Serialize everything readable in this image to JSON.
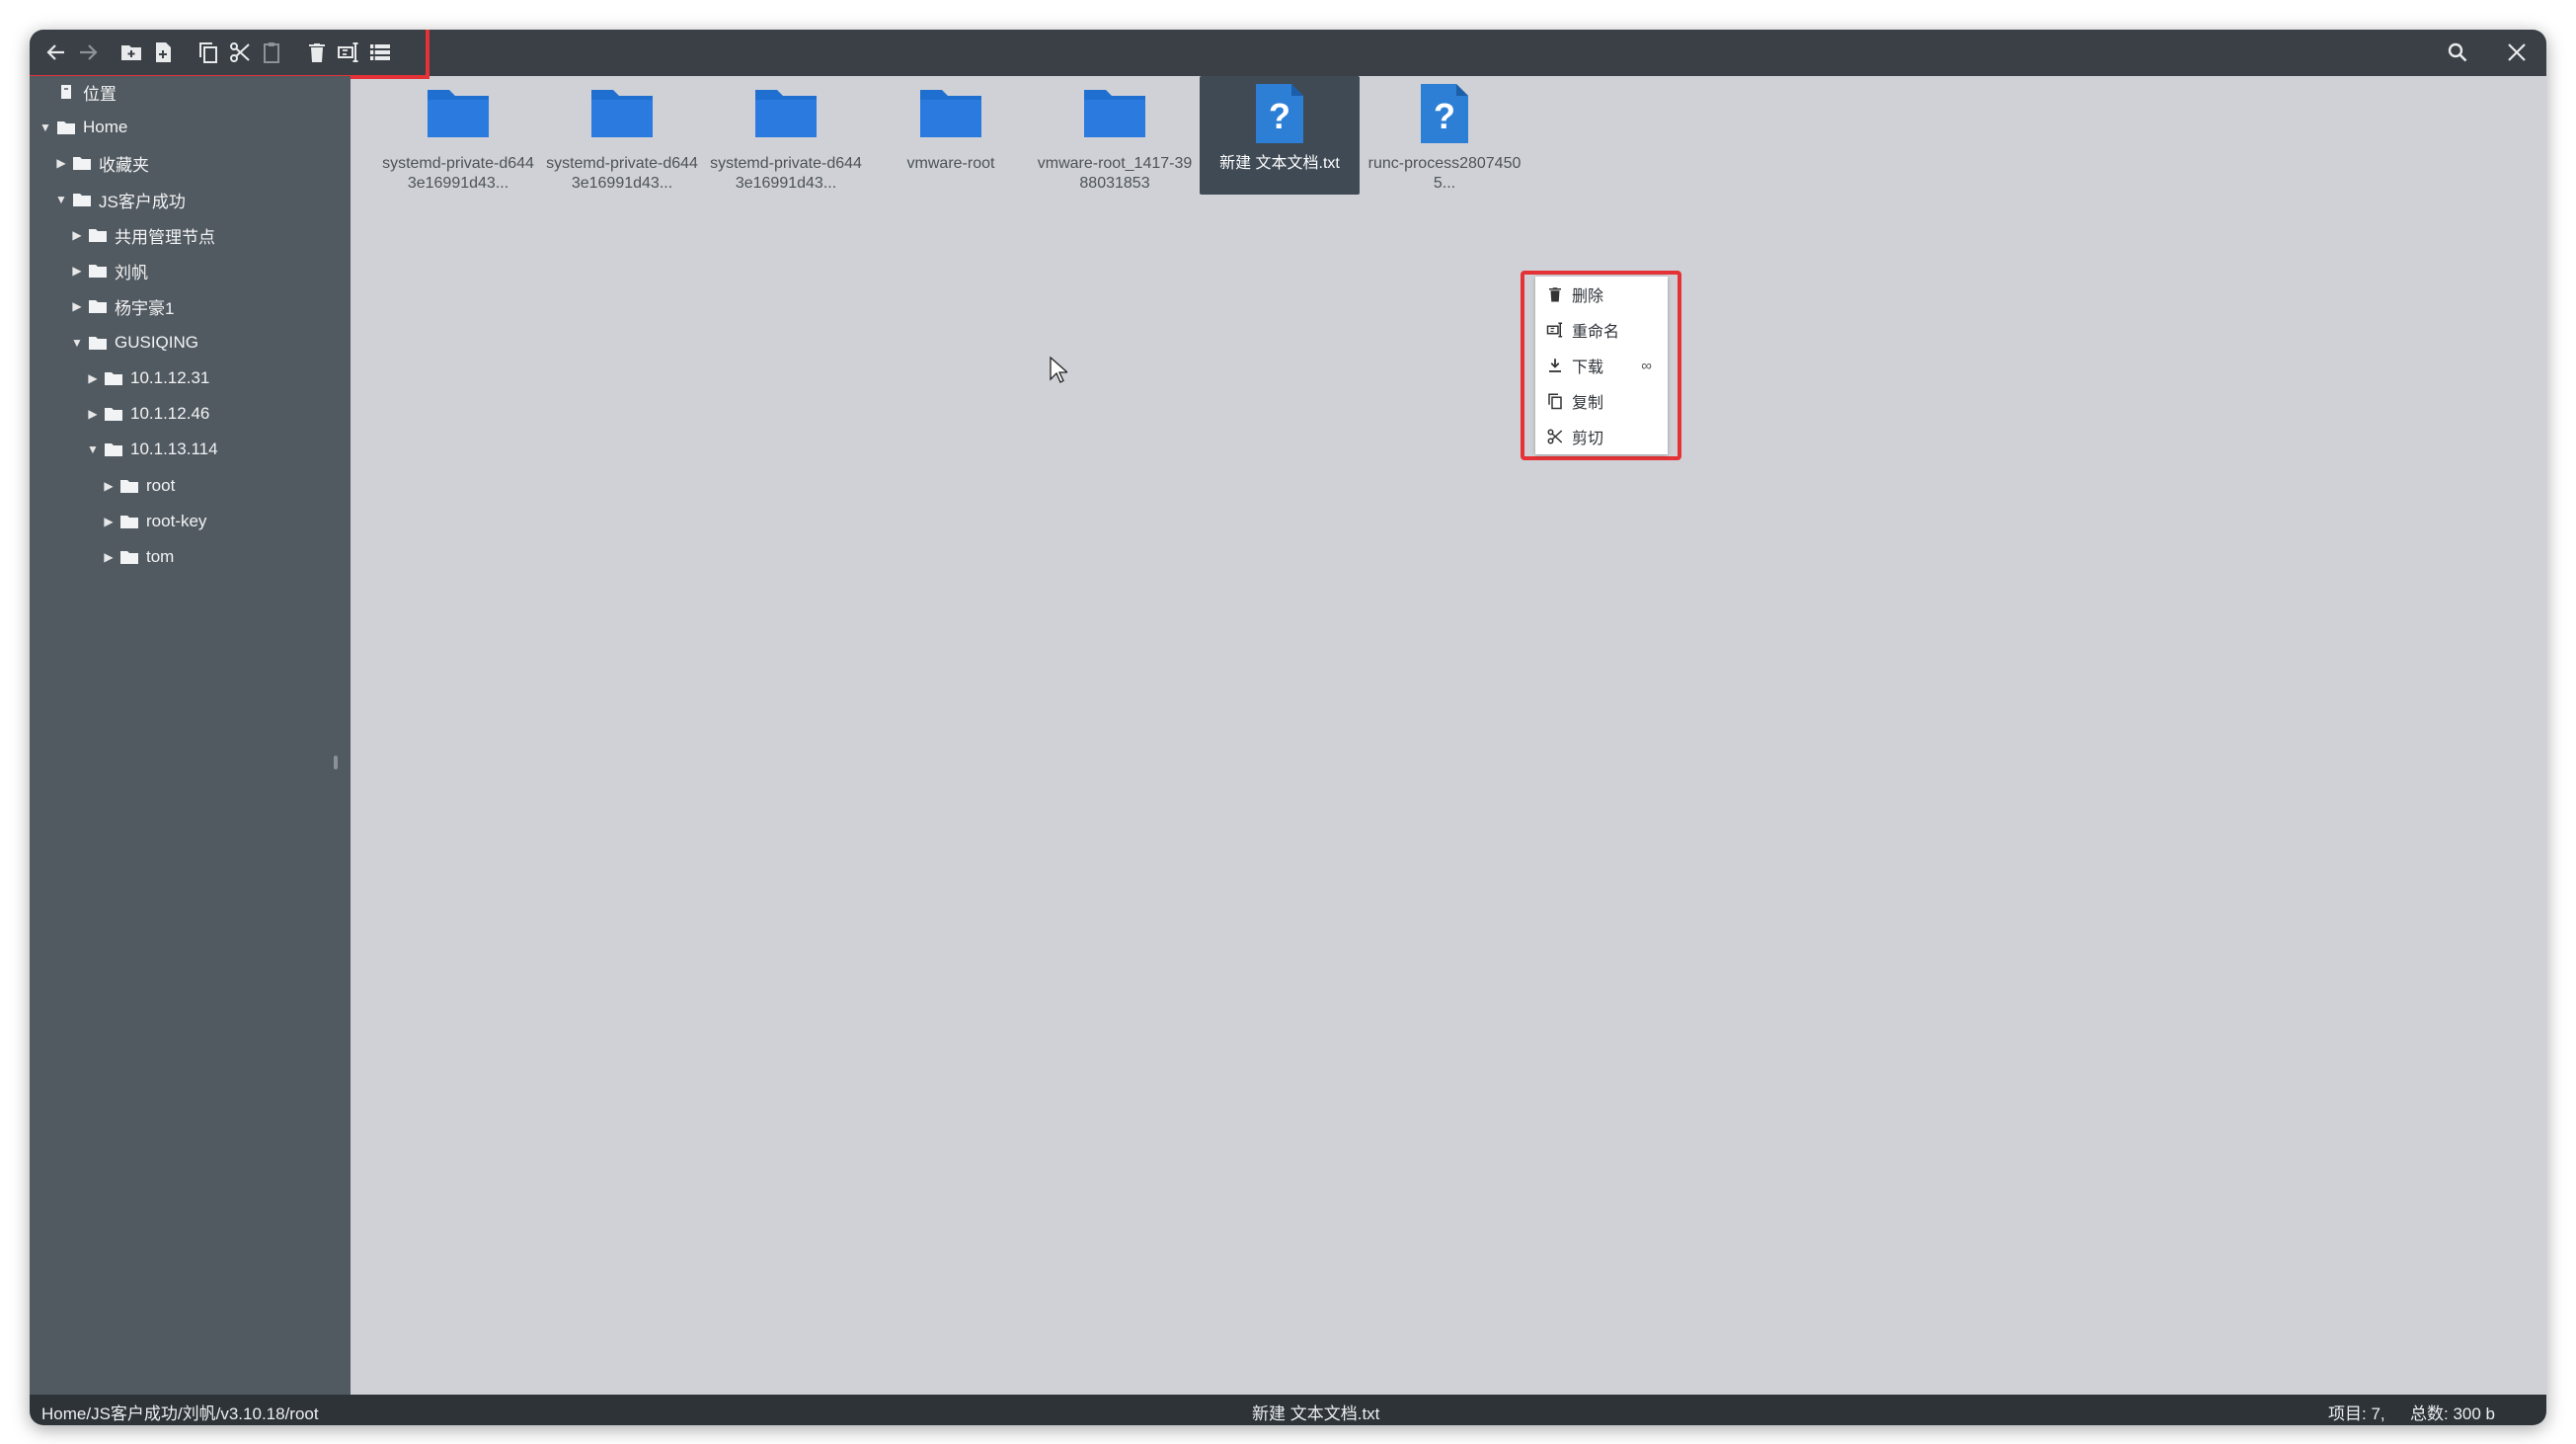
{
  "toolbar": {
    "buttons": [
      {
        "name": "back",
        "icon": "arrow-left-icon"
      },
      {
        "name": "forward",
        "icon": "arrow-right-icon"
      },
      {
        "name": "new-folder",
        "icon": "new-folder-icon"
      },
      {
        "name": "new-file",
        "icon": "new-file-icon"
      },
      {
        "name": "copy",
        "icon": "copy-icon"
      },
      {
        "name": "cut",
        "icon": "scissors-icon"
      },
      {
        "name": "paste",
        "icon": "clipboard-icon"
      },
      {
        "name": "delete",
        "icon": "trash-icon"
      },
      {
        "name": "rename",
        "icon": "rename-icon"
      },
      {
        "name": "view-toggle",
        "icon": "list-view-icon"
      }
    ],
    "right_buttons": [
      {
        "name": "search",
        "icon": "search-icon"
      },
      {
        "name": "close",
        "icon": "close-icon"
      }
    ]
  },
  "sidebar": {
    "items": [
      {
        "label": "位置",
        "level": 0,
        "caret": "none",
        "icon": "location-icon"
      },
      {
        "label": "Home",
        "level": 0,
        "caret": "down",
        "icon": "folder-icon"
      },
      {
        "label": "收藏夹",
        "level": 1,
        "caret": "right",
        "icon": "folder-icon"
      },
      {
        "label": "JS客户成功",
        "level": 1,
        "caret": "down",
        "icon": "folder-icon"
      },
      {
        "label": "共用管理节点",
        "level": 2,
        "caret": "right",
        "icon": "folder-icon"
      },
      {
        "label": "刘帆",
        "level": 2,
        "caret": "right",
        "icon": "folder-icon"
      },
      {
        "label": "杨宇豪1",
        "level": 2,
        "caret": "right",
        "icon": "folder-icon"
      },
      {
        "label": "GUSIQING",
        "level": 2,
        "caret": "down",
        "icon": "folder-icon"
      },
      {
        "label": "10.1.12.31",
        "level": 3,
        "caret": "right",
        "icon": "folder-icon"
      },
      {
        "label": "10.1.12.46",
        "level": 3,
        "caret": "right",
        "icon": "folder-icon"
      },
      {
        "label": "10.1.13.114",
        "level": 3,
        "caret": "down",
        "icon": "folder-icon"
      },
      {
        "label": "root",
        "level": 4,
        "caret": "right",
        "icon": "folder-icon"
      },
      {
        "label": "root-key",
        "level": 4,
        "caret": "right",
        "icon": "folder-icon"
      },
      {
        "label": "tom",
        "level": 4,
        "caret": "right",
        "icon": "folder-icon"
      }
    ]
  },
  "files": [
    {
      "label": "systemd-private-d6443e16991d43...",
      "type": "folder",
      "selected": false
    },
    {
      "label": "systemd-private-d6443e16991d43...",
      "type": "folder",
      "selected": false
    },
    {
      "label": "systemd-private-d6443e16991d43...",
      "type": "folder",
      "selected": false
    },
    {
      "label": "vmware-root",
      "type": "folder",
      "selected": false
    },
    {
      "label": "vmware-root_1417-3988031853",
      "type": "folder",
      "selected": false
    },
    {
      "label": "新建 文本文档.txt",
      "type": "unknown",
      "selected": true
    },
    {
      "label": "runc-process28074505...",
      "type": "unknown",
      "selected": false
    }
  ],
  "context_menu": {
    "items": [
      {
        "label": "删除",
        "icon": "trash-icon"
      },
      {
        "label": "重命名",
        "icon": "rename-icon"
      },
      {
        "label": "下载",
        "icon": "download-icon",
        "extra": "∞"
      },
      {
        "label": "复制",
        "icon": "copy-icon"
      },
      {
        "label": "剪切",
        "icon": "scissors-icon"
      }
    ]
  },
  "status": {
    "path": "Home/JS客户成功/刘帆/v3.10.18/root",
    "selected": "新建 文本文档.txt",
    "items": "项目: 7,",
    "total": "总数: 300 b"
  },
  "colors": {
    "folder": "#1f6fd1",
    "accent_red": "#e53236",
    "toolbar_bg": "#3a4045",
    "sidebar_bg": "#525a61",
    "content_bg": "#cfd1d6"
  }
}
